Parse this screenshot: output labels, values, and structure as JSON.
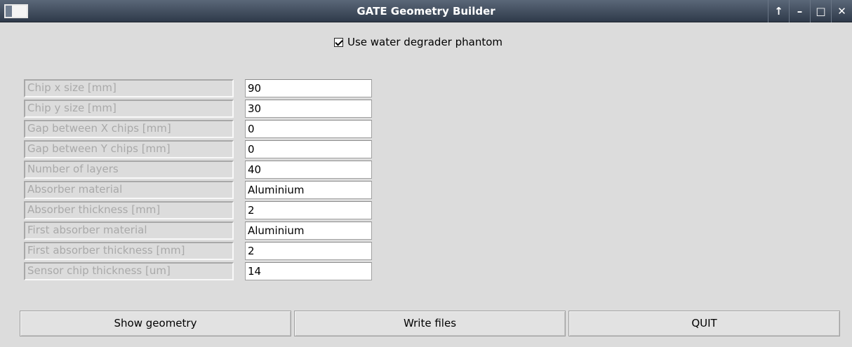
{
  "window": {
    "title": "GATE Geometry Builder",
    "controls": [
      "↑",
      "–",
      "□",
      "✕"
    ]
  },
  "phantom_checkbox": {
    "label": "Use water degrader phantom",
    "checked": true
  },
  "fields": [
    {
      "label": "Chip x size [mm]",
      "value": "90"
    },
    {
      "label": "Chip y size [mm]",
      "value": "30"
    },
    {
      "label": "Gap between X chips [mm]",
      "value": "0"
    },
    {
      "label": "Gap between Y chips [mm]",
      "value": "0"
    },
    {
      "label": "Number of layers",
      "value": "40"
    },
    {
      "label": "Absorber material",
      "value": "Aluminium"
    },
    {
      "label": "Absorber thickness [mm]",
      "value": "2"
    },
    {
      "label": "First absorber material",
      "value": "Aluminium"
    },
    {
      "label": "First absorber thickness [mm]",
      "value": "2"
    },
    {
      "label": "Sensor chip thickness [um]",
      "value": "14"
    }
  ],
  "buttons": {
    "show_geometry": "Show geometry",
    "write_files": "Write files",
    "quit": "QUIT"
  }
}
